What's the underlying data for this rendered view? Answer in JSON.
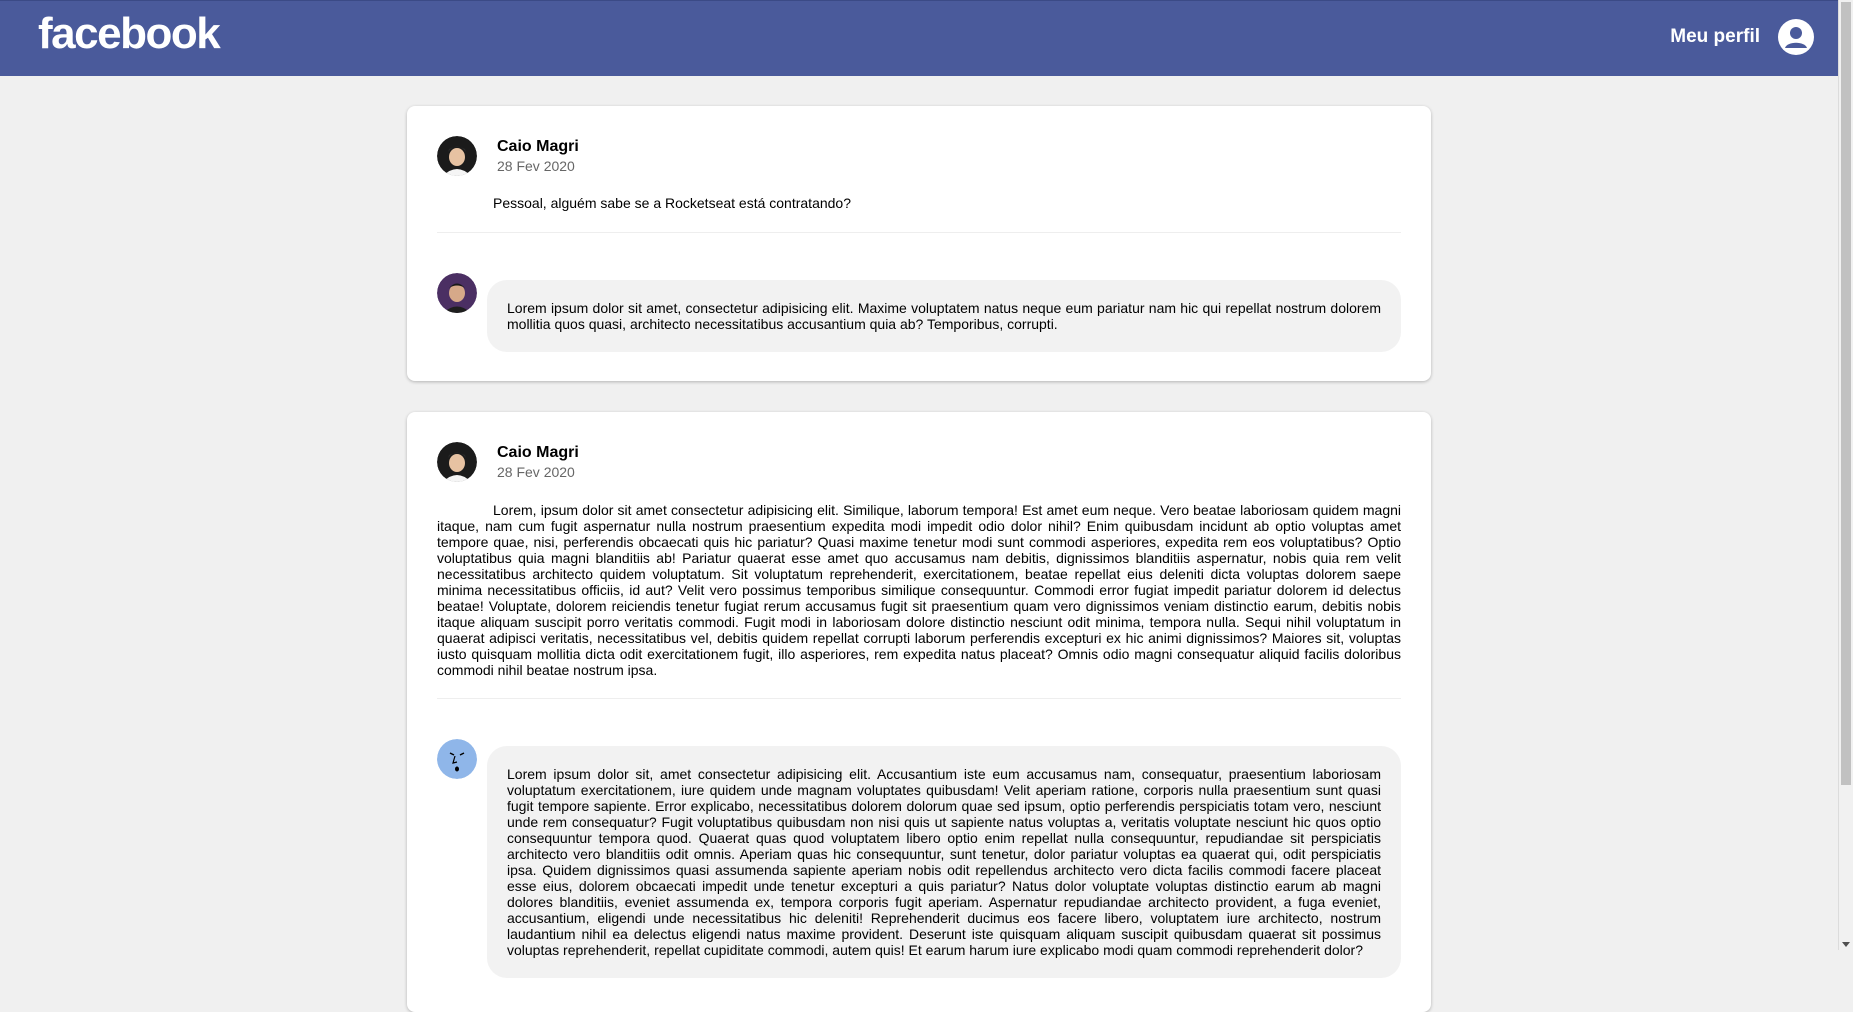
{
  "header": {
    "logo": "facebook",
    "profile_label": "Meu perfil"
  },
  "posts": [
    {
      "author": "Caio Magri",
      "date": "28 Fev 2020",
      "content": "Pessoal, alguém sabe se a Rocketseat está contratando?",
      "comment": "Lorem ipsum dolor sit amet, consectetur adipisicing elit. Maxime voluptatem natus neque eum pariatur nam hic qui repellat nostrum dolorem mollitia quos quasi, architecto necessitatibus accusantium quia ab? Temporibus, corrupti."
    },
    {
      "author": "Caio Magri",
      "date": "28 Fev 2020",
      "content": "Lorem, ipsum dolor sit amet consectetur adipisicing elit. Similique, laborum tempora! Est amet eum neque. Vero beatae laboriosam quidem magni itaque, nam cum fugit aspernatur nulla nostrum praesentium expedita modi impedit odio dolor nihil? Enim quibusdam incidunt ab optio voluptas amet tempore quae, nisi, perferendis obcaecati quis hic pariatur? Quasi maxime tenetur modi sunt commodi asperiores, expedita rem eos voluptatibus? Optio voluptatibus quia magni blanditiis ab! Pariatur quaerat esse amet quo accusamus nam debitis, dignissimos blanditiis aspernatur, nobis quia rem velit necessitatibus architecto quidem voluptatum. Sit voluptatum reprehenderit, exercitationem, beatae repellat eius deleniti dicta voluptas dolorem saepe minima necessitatibus officiis, id aut? Velit vero possimus temporibus similique consequuntur. Commodi error fugiat impedit pariatur dolorem id delectus beatae! Voluptate, dolorem reiciendis tenetur fugiat rerum accusamus fugit sit praesentium quam vero dignissimos veniam distinctio earum, debitis nobis itaque aliquam suscipit porro veritatis commodi. Fugit modi in laboriosam dolore distinctio nesciunt odit minima, tempora nulla. Sequi nihil voluptatum in quaerat adipisci veritatis, necessitatibus vel, debitis quidem repellat corrupti laborum perferendis excepturi ex hic animi dignissimos? Maiores sit, voluptas iusto quisquam mollitia dicta odit exercitationem fugit, illo asperiores, rem expedita natus placeat? Omnis odio magni consequatur aliquid facilis doloribus commodi nihil beatae nostrum ipsa.",
      "comment": "Lorem ipsum dolor sit, amet consectetur adipisicing elit. Accusantium iste eum accusamus nam, consequatur, praesentium laboriosam voluptatum exercitationem, iure quidem unde magnam voluptates quibusdam! Velit aperiam ratione, corporis nulla praesentium sunt quasi fugit tempore sapiente. Error explicabo, necessitatibus dolorem dolorum quae sed ipsum, optio perferendis perspiciatis totam vero, nesciunt unde rem consequatur? Fugit voluptatibus quibusdam non nisi quis ut sapiente natus voluptas a, veritatis voluptate nesciunt hic quos optio consequuntur tempora quod. Quaerat quas quod voluptatem libero optio enim repellat nulla consequuntur, repudiandae sit perspiciatis architecto vero blanditiis odit omnis. Aperiam quas hic consequuntur, sunt tenetur, dolor pariatur voluptas ea quaerat qui, odit perspiciatis ipsa. Quidem dignissimos quasi assumenda sapiente aperiam nobis odit repellendus architecto vero dicta facilis commodi facere placeat esse eius, dolorem obcaecati impedit unde tenetur excepturi a quis pariatur? Natus dolor voluptate voluptas distinctio earum ab magni dolores blanditiis, eveniet assumenda ex, tempora corporis fugit aperiam. Aspernatur repudiandae architecto provident, a fuga eveniet, accusantium, eligendi unde necessitatibus hic deleniti! Reprehenderit ducimus eos facere libero, voluptatem iure architecto, nostrum laudantium nihil ea delectus eligendi natus maxime provident. Deserunt iste quisquam aliquam suscipit quibusdam quaerat sit possimus voluptas reprehenderit, repellat cupiditate commodi, autem quis! Et earum harum iure explicabo modi quam commodi reprehenderit dolor?"
    }
  ],
  "colors": {
    "header_bg": "#4a5a9b",
    "page_bg": "#f0f0f0",
    "card_bg": "#ffffff",
    "bubble_bg": "#f2f2f2"
  }
}
